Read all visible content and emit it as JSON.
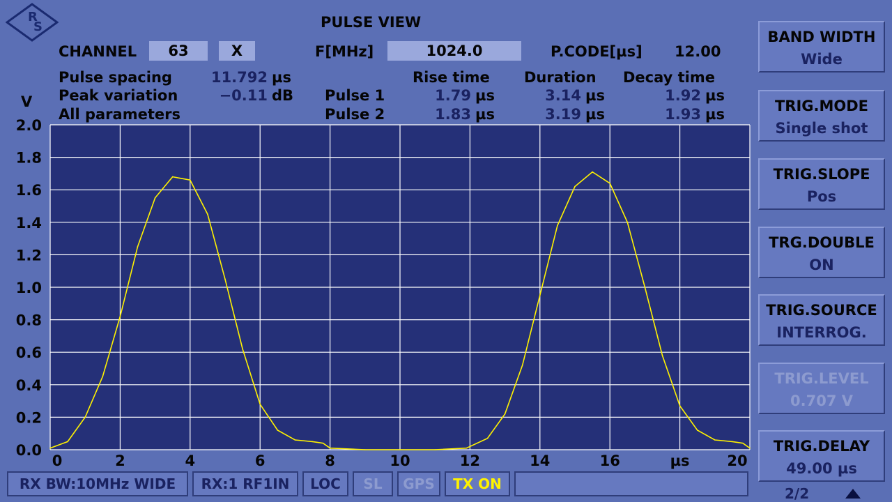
{
  "header": {
    "title": "PULSE VIEW",
    "channel_label": "CHANNEL",
    "channel_value": "63",
    "channel_mode": "X",
    "freq_label": "F[MHz]",
    "freq_value": "1024.0",
    "pcode_label": "P.CODE[µs]",
    "pcode_value": "12.00"
  },
  "measurements": {
    "pulse_spacing_label": "Pulse spacing",
    "pulse_spacing_value": "11.792",
    "pulse_spacing_unit": "µs",
    "peak_variation_label": "Peak variation",
    "peak_variation_value": "−0.11",
    "peak_variation_unit": "dB",
    "all_params_label": "All parameters",
    "col_rise": "Rise time",
    "col_duration": "Duration",
    "col_decay": "Decay time",
    "rows": [
      {
        "label": "Pulse 1",
        "rise": "1.79",
        "duration": "3.14",
        "decay": "1.92",
        "unit": "µs"
      },
      {
        "label": "Pulse 2",
        "rise": "1.83",
        "duration": "3.19",
        "decay": "1.93",
        "unit": "µs"
      }
    ]
  },
  "softkeys": [
    {
      "line1": "BAND WIDTH",
      "line2": "Wide",
      "enabled": true
    },
    {
      "line1": "TRIG.MODE",
      "line2": "Single shot",
      "enabled": true
    },
    {
      "line1": "TRIG.SLOPE",
      "line2": "Pos",
      "enabled": true
    },
    {
      "line1": "TRG.DOUBLE",
      "line2": "ON",
      "enabled": true
    },
    {
      "line1": "TRIG.SOURCE",
      "line2": "INTERROG.",
      "enabled": true
    },
    {
      "line1": "TRIG.LEVEL",
      "line2": "0.707  V",
      "enabled": false
    },
    {
      "line1": "TRIG.DELAY",
      "line2": "49.00 µs",
      "enabled": true
    }
  ],
  "page_indicator": "2/2",
  "page_icon": "triangle-up-icon",
  "status_bar": [
    {
      "text": "RX BW:10MHz WIDE",
      "state": "normal"
    },
    {
      "text": "RX:1 RF1IN",
      "state": "normal"
    },
    {
      "text": "LOC",
      "state": "normal"
    },
    {
      "text": "SL",
      "state": "off"
    },
    {
      "text": "GPS",
      "state": "off"
    },
    {
      "text": "TX ON",
      "state": "on"
    },
    {
      "text": "",
      "state": "normal"
    }
  ],
  "colors": {
    "background": "#5b6fb5",
    "plot_background": "#253078",
    "grid": "#ffffff",
    "trace": "#fff200",
    "status_on": "#fff200"
  },
  "chart_data": {
    "type": "line",
    "ylabel": "V",
    "xlabel": "µs",
    "xlim": [
      0,
      20
    ],
    "ylim": [
      0,
      2.0
    ],
    "x_ticks": [
      "0",
      "2",
      "4",
      "6",
      "8",
      "10",
      "12",
      "14",
      "16",
      "µs",
      "20"
    ],
    "y_ticks": [
      "2.0",
      "1.8",
      "1.6",
      "1.4",
      "1.2",
      "1.0",
      "0.8",
      "0.6",
      "0.4",
      "0.2",
      "0.0"
    ],
    "grid": true,
    "series": [
      {
        "x": [
          0,
          0.5,
          1,
          1.5,
          2,
          2.5,
          3,
          3.5,
          4,
          4.5,
          5,
          5.5,
          6,
          6.5,
          7,
          7.5,
          7.8,
          8,
          9,
          10,
          11,
          11.9,
          12.5,
          13,
          13.5,
          14,
          14.5,
          15,
          15.5,
          16,
          16.5,
          17,
          17.5,
          18,
          18.5,
          19,
          19.5,
          19.8,
          20
        ],
        "y": [
          0.01,
          0.05,
          0.2,
          0.45,
          0.82,
          1.25,
          1.55,
          1.68,
          1.66,
          1.45,
          1.05,
          0.62,
          0.28,
          0.12,
          0.06,
          0.05,
          0.04,
          0.01,
          0.0,
          0.0,
          0.0,
          0.01,
          0.07,
          0.22,
          0.52,
          0.95,
          1.38,
          1.62,
          1.71,
          1.64,
          1.4,
          1.0,
          0.58,
          0.27,
          0.12,
          0.06,
          0.05,
          0.04,
          0.01
        ]
      }
    ]
  }
}
